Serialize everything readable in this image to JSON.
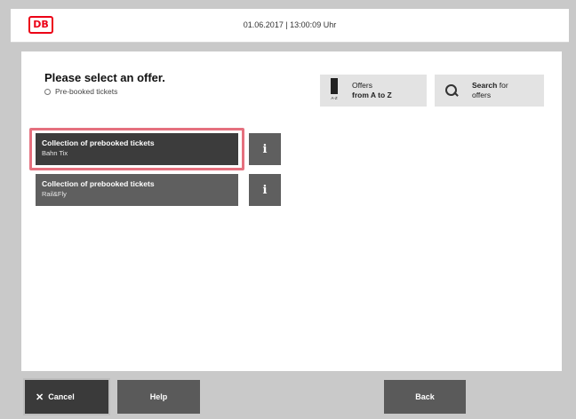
{
  "header": {
    "logo_text": "DB",
    "datetime": "01.06.2017 | 13:00:09 Uhr",
    "brand_color": "#ec0016"
  },
  "main": {
    "title": "Please select an offer.",
    "subtitle": "Pre-booked tickets",
    "toolbar": {
      "offers_az": {
        "line1": "Offers",
        "line2": "from A to Z",
        "icon_label": "A-Z"
      },
      "search": {
        "bold": "Search",
        "rest": "for",
        "line2": "offers"
      }
    },
    "offers": [
      {
        "title": "Collection of prebooked tickets",
        "subtitle": "Bahn Tix",
        "selected": true
      },
      {
        "title": "Collection of prebooked tickets",
        "subtitle": "Rail&Fly",
        "selected": false
      }
    ],
    "info_icon": "i"
  },
  "footer": {
    "cancel_icon": "✕",
    "cancel": "Cancel",
    "help": "Help",
    "back": "Back"
  }
}
